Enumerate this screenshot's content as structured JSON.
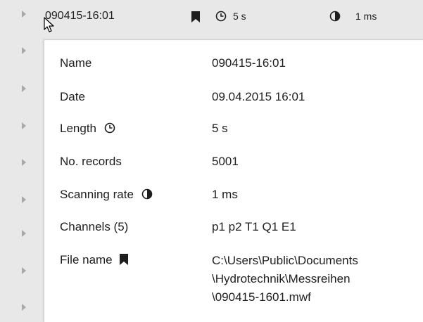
{
  "header": {
    "title": "090415-16:01",
    "length": "5 s",
    "scanning_rate": "1 ms"
  },
  "details": {
    "name_label": "Name",
    "name_value": "090415-16:01",
    "date_label": "Date",
    "date_value": "09.04.2015 16:01",
    "length_label": "Length",
    "length_value": "5 s",
    "records_label": "No. records",
    "records_value": "5001",
    "rate_label": "Scanning rate",
    "rate_value": "1 ms",
    "channels_label": "Channels (5)",
    "channels_value": "p1 p2 T1 Q1 E1",
    "file_label": "File name",
    "file_value_lines": [
      "C:\\Users\\Public\\Documents",
      "\\Hydrotechnik\\Messreihen",
      "\\090415-1601.mwf"
    ]
  },
  "icons": {
    "bookmark": "bookmark-icon",
    "clock": "clock-icon",
    "pie": "pie-chart-icon",
    "expander": "expand-arrow-icon",
    "cursor": "mouse-cursor"
  },
  "colors": {
    "background": "#e8e8e8",
    "panel": "#ffffff",
    "text": "#1e1e1e",
    "arrow": "#a9a9a9"
  }
}
